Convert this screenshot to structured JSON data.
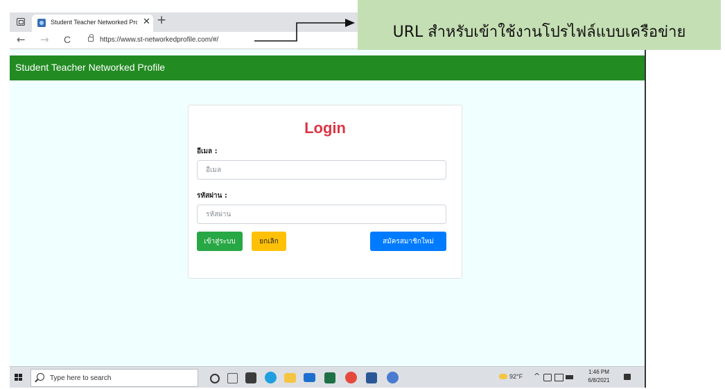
{
  "browser": {
    "tab_title": "Student Teacher Networked Prof",
    "tab_close": "✕",
    "new_tab": "+",
    "back": "←",
    "forward": "→",
    "reload": "C",
    "url": "https://www.st-networkedprofile.com/#/"
  },
  "app": {
    "title": "Student Teacher Networked Profile"
  },
  "login": {
    "heading": "Login",
    "email_label": "อีเมล :",
    "email_placeholder": "อีเมล",
    "password_label": "รหัสผ่าน :",
    "password_placeholder": "รหัสผ่าน",
    "login_button": "เข้าสู่ระบบ",
    "cancel_button": "ยกเลิก",
    "register_button": "สมัครสมาชิกใหม่"
  },
  "taskbar": {
    "search_placeholder": "Type here to search",
    "weather": "92°F",
    "tray_chevron": "^",
    "time": "1:46 PM",
    "date": "6/8/2021",
    "icons": [
      "task-view-icon",
      "store-icon",
      "edge-icon",
      "file-explorer-icon",
      "mail-icon",
      "excel-icon",
      "chrome-icon",
      "word-icon",
      "browser-icon"
    ]
  },
  "annotation": {
    "text": "URL สำหรับเข้าใช้งานโปรไฟล์แบบเครือข่าย"
  },
  "colors": {
    "header_green": "#228b22",
    "login_red": "#dc3545",
    "success": "#28a745",
    "warning": "#ffc107",
    "primary": "#007bff",
    "page_bg": "#f0ffff",
    "annotation_bg": "#c5dfb4"
  }
}
